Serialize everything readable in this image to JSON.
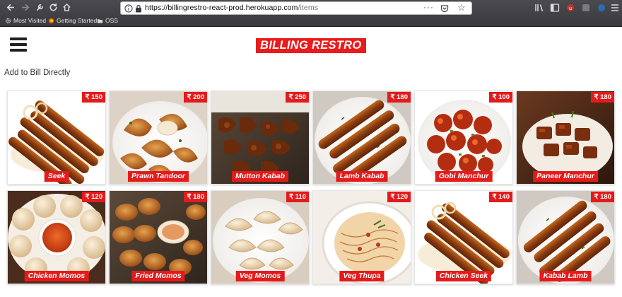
{
  "browser": {
    "url_host": "https://billingrestro-react-prod.herokuapp.com",
    "url_path": "/items",
    "bookmarks": [
      {
        "label": "Most Visited",
        "icon": "gear-icon"
      },
      {
        "label": "Getting Started",
        "icon": "firefox-icon"
      },
      {
        "label": "OSS",
        "icon": "folder-icon"
      }
    ]
  },
  "header": {
    "brand": "BILLING RESTRO",
    "menu_icon": "hamburger-menu-icon"
  },
  "main": {
    "add_to_bill_label": "Add to Bill Directly",
    "items": [
      {
        "name": "Seek",
        "price": "₹ 150",
        "image": "seekh-kebab"
      },
      {
        "name": "Prawn Tandoor",
        "price": "₹ 200",
        "image": "prawn-tandoor"
      },
      {
        "name": "Mutton Kabab",
        "price": "₹ 250",
        "image": "mutton-kabab"
      },
      {
        "name": "Lamb Kabab",
        "price": "₹ 180",
        "image": "lamb-kabab"
      },
      {
        "name": "Gobi Manchur",
        "price": "₹ 100",
        "image": "gobi-manchurian"
      },
      {
        "name": "Paneer Manchur",
        "price": "₹ 180",
        "image": "paneer-manchurian"
      },
      {
        "name": "Chicken Momos",
        "price": "₹ 120",
        "image": "chicken-momos"
      },
      {
        "name": "Fried Momos",
        "price": "₹ 180",
        "image": "fried-momos"
      },
      {
        "name": "Veg Momos",
        "price": "₹ 110",
        "image": "veg-momos"
      },
      {
        "name": "Veg Thupa",
        "price": "₹ 120",
        "image": "veg-thukpa"
      },
      {
        "name": "Chicken Seek",
        "price": "₹ 140",
        "image": "chicken-seekh"
      },
      {
        "name": "Kabab Lamb",
        "price": "₹ 180",
        "image": "lamb-kabab-plate"
      }
    ]
  },
  "colors": {
    "accent_red": "#e31b1b",
    "chrome_dark": "#3a3a3e"
  }
}
